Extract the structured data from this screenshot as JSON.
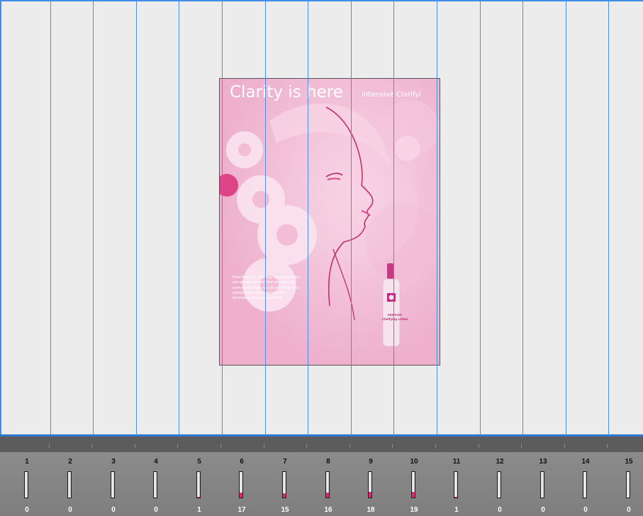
{
  "document": {
    "headline": "Clarity is here",
    "subhead": "Intensive Clarifyi",
    "body_copy": "Now there is a new way to have the skin you always wanted. Skin so clear and even-toned, feels so soft and shiny as a spring flower. Our new high-end technology has achieved it all.",
    "bottle_label": "Intensive Clarifying Lotion",
    "accent_color": "#e6237d",
    "background_color": "#f3c2d8"
  },
  "meters": [
    {
      "label": "1",
      "count": "0",
      "level": 0
    },
    {
      "label": "2",
      "count": "0",
      "level": 0
    },
    {
      "label": "3",
      "count": "0",
      "level": 0
    },
    {
      "label": "4",
      "count": "0",
      "level": 0
    },
    {
      "label": "5",
      "count": "1",
      "level": 0.02
    },
    {
      "label": "6",
      "count": "17",
      "level": 0.2
    },
    {
      "label": "7",
      "count": "15",
      "level": 0.18
    },
    {
      "label": "8",
      "count": "16",
      "level": 0.19
    },
    {
      "label": "9",
      "count": "18",
      "level": 0.21
    },
    {
      "label": "10",
      "count": "19",
      "level": 0.22
    },
    {
      "label": "11",
      "count": "1",
      "level": 0.02
    },
    {
      "label": "12",
      "count": "0",
      "level": 0
    },
    {
      "label": "13",
      "count": "0",
      "level": 0
    },
    {
      "label": "14",
      "count": "0",
      "level": 0
    },
    {
      "label": "15",
      "count": "0",
      "level": 0
    }
  ],
  "meter_fill_color": "#e6237d",
  "guide_color": "#4a90e2"
}
